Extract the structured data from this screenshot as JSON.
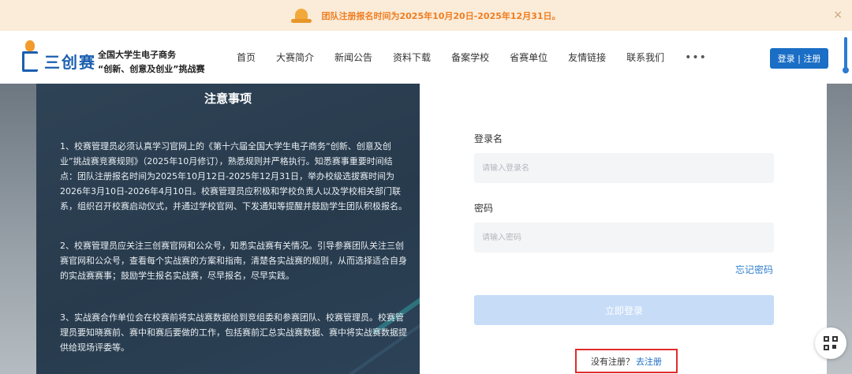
{
  "notice": {
    "text": "团队注册报名时间为2025年10月20日-2025年12月31日。",
    "close": "×"
  },
  "header": {
    "brand": "三创赛",
    "subtitle_line1": "全国大学生电子商务",
    "subtitle_line2": "“创新、创意及创业”挑战赛",
    "nav": [
      "首页",
      "大赛简介",
      "新闻公告",
      "资料下载",
      "备案学校",
      "省赛单位",
      "友情链接",
      "联系我们"
    ],
    "more": "•••",
    "login_register": "登录 | 注册"
  },
  "notes": {
    "title": "注意事项",
    "p1": "1、校赛管理员必须认真学习官网上的《第十六届全国大学生电子商务“创新、创意及创业”挑战赛竞赛规则》（2025年10月修订），熟悉规则并严格执行。知悉赛事重要时间结点：团队注册报名时间为2025年10月12日-2025年12月31日，举办校级选拔赛时间为2026年3月10日-2026年4月10日。校赛管理员应积极和学校负责人以及学校相关部门联系，组织召开校赛启动仪式，并通过学校官网、下发通知等提醒并鼓励学生团队积极报名。",
    "p2": "2、校赛管理员应关注三创赛官网和公众号，知悉实战赛有关情况。引导参赛团队关注三创赛官网和公众号，查看每个实战赛的方案和指南，清楚各实战赛的规则，从而选择适合自身的实战赛赛事；鼓励学生报名实战赛，尽早报名，尽早实践。",
    "p3": "3、实战赛合作单位会在校赛前将实战赛数据给到竞组委和参赛团队、校赛管理员。校赛管理员要知晓赛前、赛中和赛后要做的工作，包括赛前汇总实战赛数据、赛中将实战赛数据提供给现场评委等。"
  },
  "form": {
    "username_label": "登录名",
    "username_placeholder": "请输入登录名",
    "password_label": "密码",
    "password_placeholder": "请输入密码",
    "forgot": "忘记密码",
    "submit": "立即登录",
    "no_account": "没有注册？",
    "register_link": "去注册"
  },
  "colors": {
    "accent": "#1a6ec5",
    "notice_text": "#ef7e21",
    "highlight_border": "#e12c2c",
    "panel_bg": "#2f4356"
  }
}
